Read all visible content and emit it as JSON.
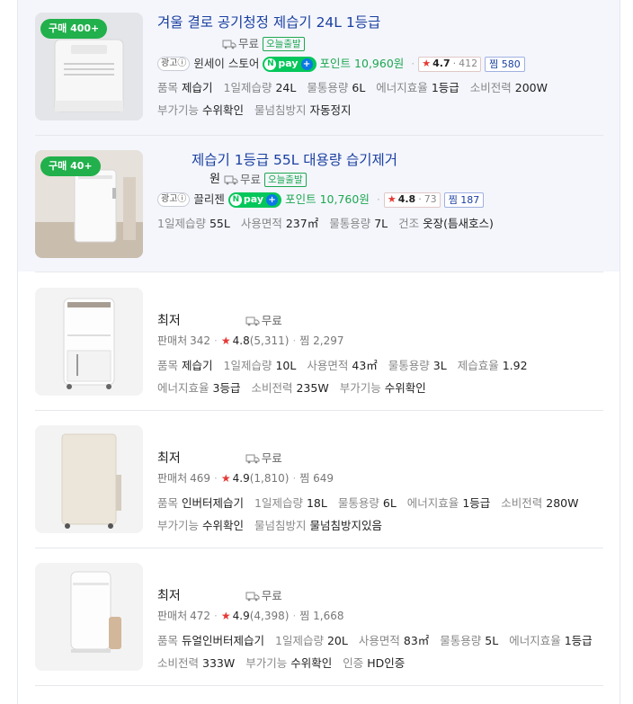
{
  "colors": {
    "green": "#21b04b",
    "title_blue": "#1a3fa0",
    "star_red": "#e53935",
    "ad_bg": "#f4f6fc"
  },
  "icons": {
    "ship": "truck-icon",
    "star": "star-icon",
    "info": "info-circle-icon"
  },
  "ad_items": [
    {
      "badge": "구매 400+",
      "title": "겨울 결로 공기청정 제습기 24L 1등급",
      "price": "",
      "ship": "무료",
      "today": "오늘출발",
      "ad_label": "광고ⓘ",
      "seller": "윈세이 스토어",
      "npay": "pay",
      "point_label": "포인트",
      "point_value": "10,960원",
      "rating": "4.7",
      "rating_count": "412",
      "zzim": "찜 580",
      "specs": [
        {
          "k": "품목",
          "v": "제습기"
        },
        {
          "k": "1일제습량",
          "v": "24L"
        },
        {
          "k": "물통용량",
          "v": "6L"
        },
        {
          "k": "에너지효율",
          "v": "1등급"
        },
        {
          "k": "소비전력",
          "v": "200W"
        },
        {
          "k": "부가기능",
          "v": "수위확인"
        },
        {
          "k": "물넘침방지",
          "v": "자동정지"
        }
      ]
    },
    {
      "badge": "구매 40+",
      "title": "제습기 1등급 55L 대용량 습기제거",
      "price": "원",
      "ship": "무료",
      "today": "오늘출발",
      "ad_label": "광고ⓘ",
      "seller": "끌리젠",
      "npay": "pay",
      "point_label": "포인트",
      "point_value": "10,760원",
      "rating": "4.8",
      "rating_count": "73",
      "zzim": "찜 187",
      "specs": [
        {
          "k": "1일제습량",
          "v": "55L"
        },
        {
          "k": "사용면적",
          "v": "237㎡"
        },
        {
          "k": "물통용량",
          "v": "7L"
        },
        {
          "k": "건조",
          "v": "옷장(틈새호스)"
        }
      ]
    }
  ],
  "items": [
    {
      "title": "최저",
      "ship": "무료",
      "sellers_label": "판매처",
      "sellers": "342",
      "rating": "4.8",
      "rating_count": "(5,311)",
      "zzim": "찜 2,297",
      "specs": [
        {
          "k": "품목",
          "v": "제습기"
        },
        {
          "k": "1일제습량",
          "v": "10L"
        },
        {
          "k": "사용면적",
          "v": "43㎡"
        },
        {
          "k": "물통용량",
          "v": "3L"
        },
        {
          "k": "제습효율",
          "v": "1.92"
        },
        {
          "k": "에너지효율",
          "v": "3등급"
        },
        {
          "k": "소비전력",
          "v": "235W"
        },
        {
          "k": "부가기능",
          "v": "수위확인"
        }
      ]
    },
    {
      "title": "최저",
      "ship": "무료",
      "sellers_label": "판매처",
      "sellers": "469",
      "rating": "4.9",
      "rating_count": "(1,810)",
      "zzim": "찜 649",
      "specs": [
        {
          "k": "품목",
          "v": "인버터제습기"
        },
        {
          "k": "1일제습량",
          "v": "18L"
        },
        {
          "k": "물통용량",
          "v": "6L"
        },
        {
          "k": "에너지효율",
          "v": "1등급"
        },
        {
          "k": "소비전력",
          "v": "280W"
        },
        {
          "k": "부가기능",
          "v": "수위확인"
        },
        {
          "k": "물넘침방지",
          "v": "물넘침방지있음"
        }
      ]
    },
    {
      "title": "최저",
      "ship": "무료",
      "sellers_label": "판매처",
      "sellers": "472",
      "rating": "4.9",
      "rating_count": "(4,398)",
      "zzim": "찜 1,668",
      "specs": [
        {
          "k": "품목",
          "v": "듀얼인버터제습기"
        },
        {
          "k": "1일제습량",
          "v": "20L"
        },
        {
          "k": "사용면적",
          "v": "83㎡"
        },
        {
          "k": "물통용량",
          "v": "5L"
        },
        {
          "k": "에너지효율",
          "v": "1등급"
        },
        {
          "k": "소비전력",
          "v": "333W"
        },
        {
          "k": "부가기능",
          "v": "수위확인"
        },
        {
          "k": "인증",
          "v": "HD인증"
        }
      ]
    }
  ]
}
